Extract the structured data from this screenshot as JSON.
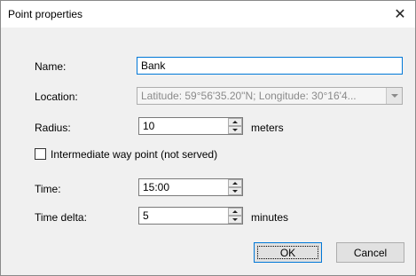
{
  "dialog": {
    "title": "Point properties",
    "close_symbol": "✕"
  },
  "name": {
    "label": "Name:",
    "value": "Bank"
  },
  "location": {
    "label": "Location:",
    "value": "Latitude: 59°56'35.20\"N; Longitude: 30°16'4..."
  },
  "radius": {
    "label": "Radius:",
    "value": "10",
    "unit": "meters"
  },
  "intermediate": {
    "label": "Intermediate way point (not served)",
    "checked": false
  },
  "time": {
    "label": "Time:",
    "value": "15:00"
  },
  "time_delta": {
    "label": "Time delta:",
    "value": "5",
    "unit": "minutes"
  },
  "buttons": {
    "ok": "OK",
    "cancel": "Cancel"
  },
  "colors": {
    "focus_accent": "#0078d7",
    "dialog_bg": "#f0f0f0"
  },
  "icons": {
    "close": "close-icon",
    "dropdown": "chevron-down-icon",
    "spin_up": "spin-up-icon",
    "spin_down": "spin-down-icon"
  }
}
